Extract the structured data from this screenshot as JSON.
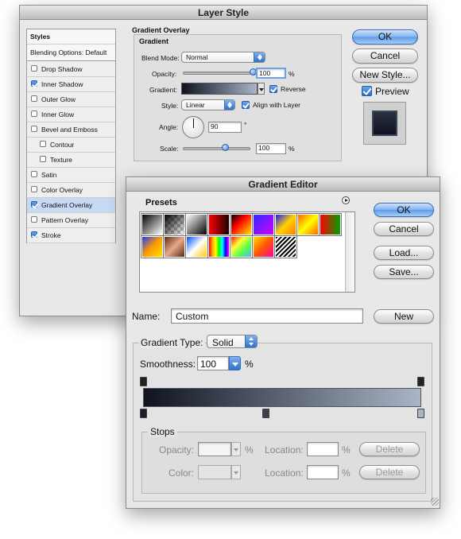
{
  "layer_style": {
    "title": "Layer Style",
    "styles_header": "Styles",
    "blending_options": "Blending Options: Default",
    "items": [
      {
        "label": "Drop Shadow",
        "checked": false,
        "indent": false,
        "selected": false
      },
      {
        "label": "Inner Shadow",
        "checked": true,
        "indent": false,
        "selected": false
      },
      {
        "label": "Outer Glow",
        "checked": false,
        "indent": false,
        "selected": false
      },
      {
        "label": "Inner Glow",
        "checked": false,
        "indent": false,
        "selected": false
      },
      {
        "label": "Bevel and Emboss",
        "checked": false,
        "indent": false,
        "selected": false
      },
      {
        "label": "Contour",
        "checked": false,
        "indent": true,
        "selected": false
      },
      {
        "label": "Texture",
        "checked": false,
        "indent": true,
        "selected": false
      },
      {
        "label": "Satin",
        "checked": false,
        "indent": false,
        "selected": false
      },
      {
        "label": "Color Overlay",
        "checked": false,
        "indent": false,
        "selected": false
      },
      {
        "label": "Gradient Overlay",
        "checked": true,
        "indent": false,
        "selected": true
      },
      {
        "label": "Pattern Overlay",
        "checked": false,
        "indent": false,
        "selected": false
      },
      {
        "label": "Stroke",
        "checked": true,
        "indent": false,
        "selected": false
      }
    ],
    "panel_title": "Gradient Overlay",
    "group_title": "Gradient",
    "blend_mode_label": "Blend Mode:",
    "blend_mode_value": "Normal",
    "opacity_label": "Opacity:",
    "opacity_value": "100",
    "opacity_unit": "%",
    "gradient_label": "Gradient:",
    "reverse_label": "Reverse",
    "reverse_checked": true,
    "style_label": "Style:",
    "style_value": "Linear",
    "align_label": "Align with Layer",
    "align_checked": true,
    "angle_label": "Angle:",
    "angle_value": "90",
    "angle_unit": "°",
    "scale_label": "Scale:",
    "scale_value": "100",
    "scale_unit": "%",
    "ok_label": "OK",
    "cancel_label": "Cancel",
    "new_style_label": "New Style...",
    "preview_label": "Preview",
    "preview_checked": true
  },
  "gradient_editor": {
    "title": "Gradient Editor",
    "presets_label": "Presets",
    "ok_label": "OK",
    "cancel_label": "Cancel",
    "load_label": "Load...",
    "save_label": "Save...",
    "name_label": "Name:",
    "name_value": "Custom",
    "new_label": "New",
    "gradient_type_label": "Gradient Type:",
    "gradient_type_value": "Solid",
    "smoothness_label": "Smoothness:",
    "smoothness_value": "100",
    "smoothness_unit": "%",
    "stops_title": "Stops",
    "opacity_label": "Opacity:",
    "opacity_unit": "%",
    "location_label": "Location:",
    "location_unit": "%",
    "delete_label": "Delete",
    "color_label": "Color:",
    "location2_label": "Location:",
    "location2_unit": "%",
    "delete2_label": "Delete"
  },
  "colors": {
    "gradient_start": "#0f1220",
    "gradient_end": "#a9b6c8",
    "selection": "#c7daf5",
    "accent": "#3b7fd8"
  }
}
